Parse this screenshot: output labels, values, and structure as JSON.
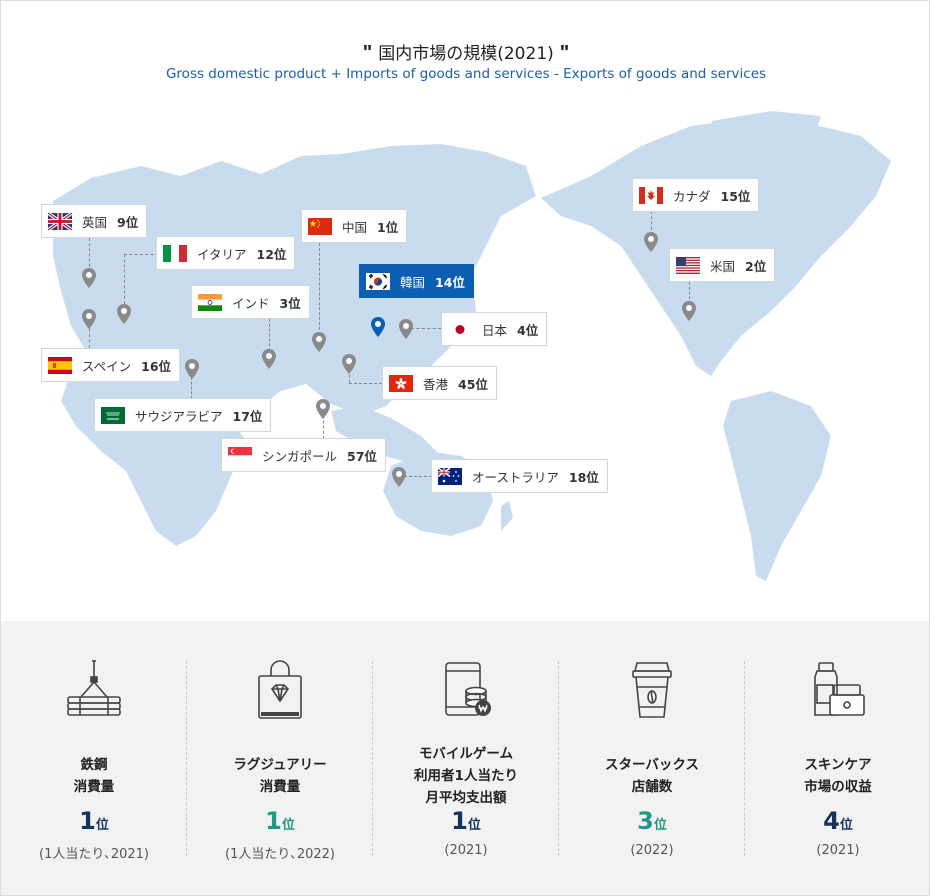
{
  "header": {
    "quote_open": "\"",
    "title": "国内市場の規模(2021)",
    "quote_close": "\"",
    "subtitle": "Gross domestic product + Imports of goods and services - Exports of goods and services"
  },
  "countries": [
    {
      "key": "uk",
      "name": "英国",
      "rank": "9位"
    },
    {
      "key": "italy",
      "name": "イタリア",
      "rank": "12位"
    },
    {
      "key": "india",
      "name": "インド",
      "rank": "3位"
    },
    {
      "key": "china",
      "name": "中国",
      "rank": "1位"
    },
    {
      "key": "korea",
      "name": "韓国",
      "rank": "14位",
      "highlight": true
    },
    {
      "key": "japan",
      "name": "日本",
      "rank": "4位"
    },
    {
      "key": "spain",
      "name": "スペイン",
      "rank": "16位"
    },
    {
      "key": "hongkong",
      "name": "香港",
      "rank": "45位"
    },
    {
      "key": "saudi",
      "name": "サウジアラビア",
      "rank": "17位"
    },
    {
      "key": "singapore",
      "name": "シンガポール",
      "rank": "57位"
    },
    {
      "key": "australia",
      "name": "オーストラリア",
      "rank": "18位"
    },
    {
      "key": "canada",
      "name": "カナダ",
      "rank": "15位"
    },
    {
      "key": "usa",
      "name": "米国",
      "rank": "2位"
    }
  ],
  "stats": [
    {
      "name": "鉄鋼\n消費量",
      "rank": "1",
      "unit": "位",
      "note": "(1人当たり､2021)",
      "icon": "steel-icon",
      "color": "#16335b"
    },
    {
      "name": "ラグジュアリー\n消費量",
      "rank": "1",
      "unit": "位",
      "note": "(1人当たり､2022)",
      "icon": "luxury-bag-icon",
      "color": "#1d9a86"
    },
    {
      "name": "モバイルゲーム\n利用者1人当たり\n月平均支出額",
      "rank": "1",
      "unit": "位",
      "note": "(2021)",
      "icon": "mobile-game-icon",
      "color": "#16335b"
    },
    {
      "name": "スターバックス\n店舗数",
      "rank": "3",
      "unit": "位",
      "note": "(2022)",
      "icon": "coffee-cup-icon",
      "color": "#1d9a86"
    },
    {
      "name": "スキンケア\n市場の収益",
      "rank": "4",
      "unit": "位",
      "note": "(2021)",
      "icon": "skincare-icon",
      "color": "#16335b"
    }
  ],
  "colors": {
    "map": "#c9dcef",
    "pin": "#8a8a8a",
    "highlight": "#0c5eb3",
    "rank_dark": "#16335b",
    "rank_teal": "#1d9a86"
  }
}
